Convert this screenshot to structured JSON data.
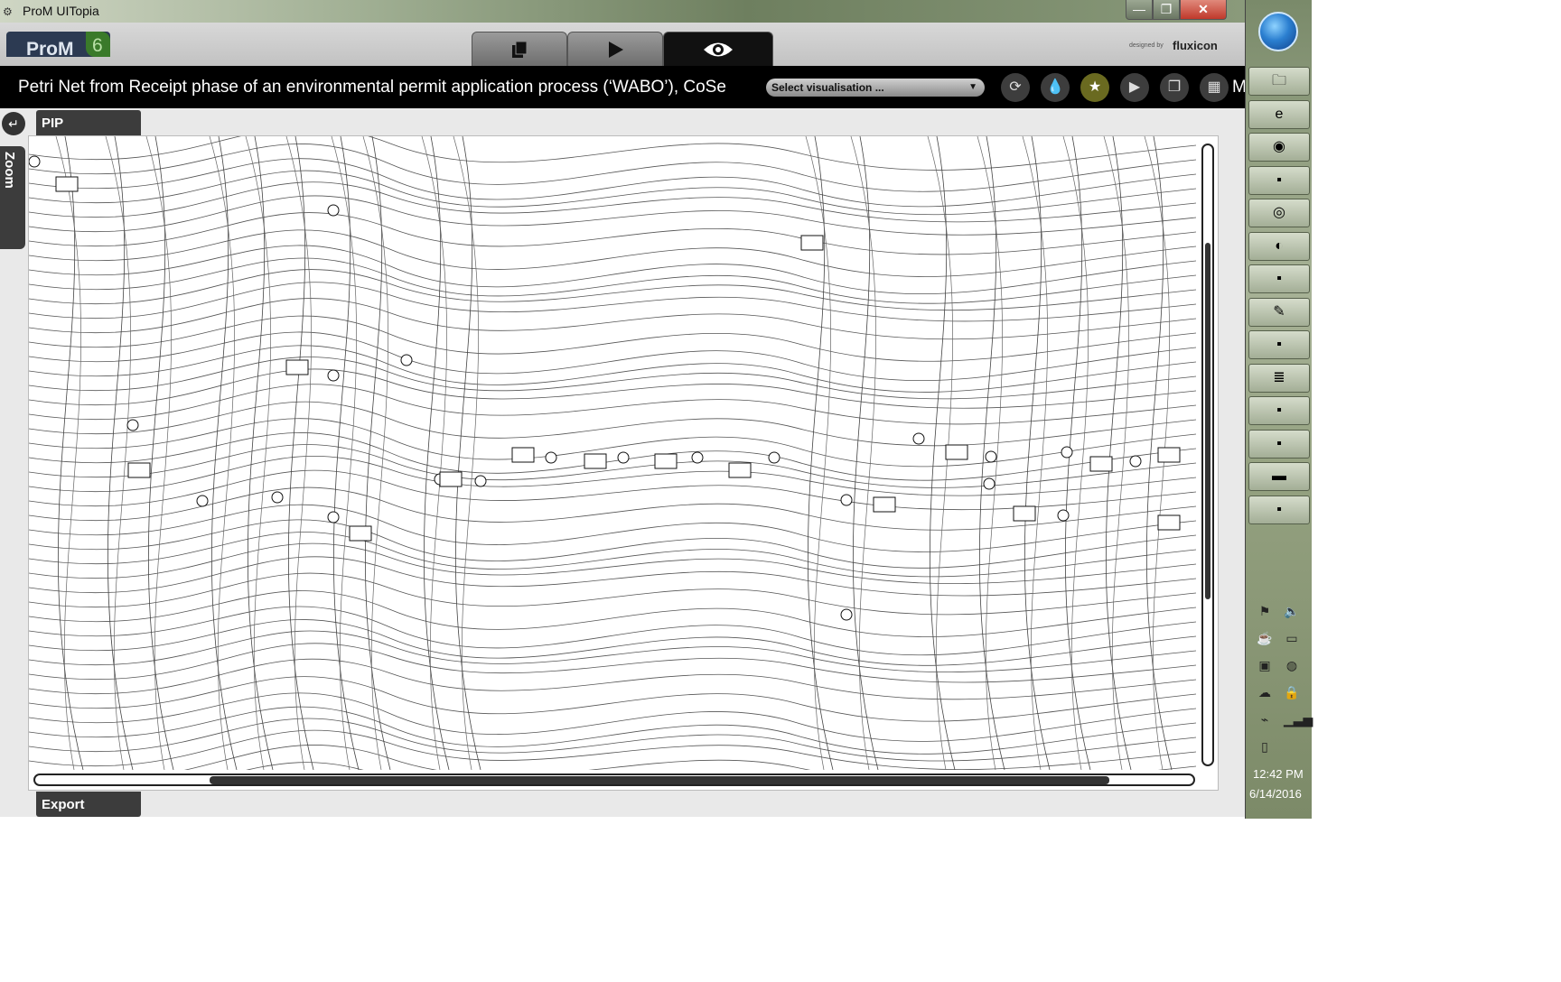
{
  "window": {
    "title": "ProM UITopia",
    "minimize_label": "—",
    "maximize_label": "❐",
    "close_label": "✕"
  },
  "header": {
    "logo_text": "ProM",
    "logo_version": "6",
    "tabs": [
      {
        "name": "workspace",
        "icon": "copy-icon",
        "active": false
      },
      {
        "name": "actions",
        "icon": "play-icon",
        "active": false
      },
      {
        "name": "views",
        "icon": "eye-icon",
        "active": true
      }
    ],
    "designed_by": "designed by",
    "brand": "fluxicon"
  },
  "viewbar": {
    "title": "Petri Net from Receipt phase of an environmental permit application process (‘WABO’), CoSe",
    "select_placeholder": "Select visualisation ...",
    "trailing_text": "M",
    "buttons": [
      {
        "icon": "refresh-icon"
      },
      {
        "icon": "drop-icon"
      },
      {
        "icon": "star-icon"
      },
      {
        "icon": "play-icon"
      },
      {
        "icon": "copy-icon"
      },
      {
        "icon": "grid-icon"
      }
    ]
  },
  "main": {
    "pip_label": "PIP",
    "zoom_label": "Zoom",
    "export_label": "Export"
  },
  "taskbar": {
    "time": "12:42 PM",
    "date": "6/14/2016",
    "pinned": [
      "folder-icon",
      "ie-icon",
      "firefox-icon",
      "app-icon",
      "chrome-icon",
      "eclipse-icon",
      "app-icon",
      "notepad-icon",
      "app-icon",
      "database-icon",
      "app-icon",
      "app-icon",
      "cmd-icon",
      "app-icon"
    ]
  },
  "colors": {
    "accent_tab": "#111111",
    "panel_dark": "#3c3c3c",
    "star_button": "#6a6a20"
  }
}
